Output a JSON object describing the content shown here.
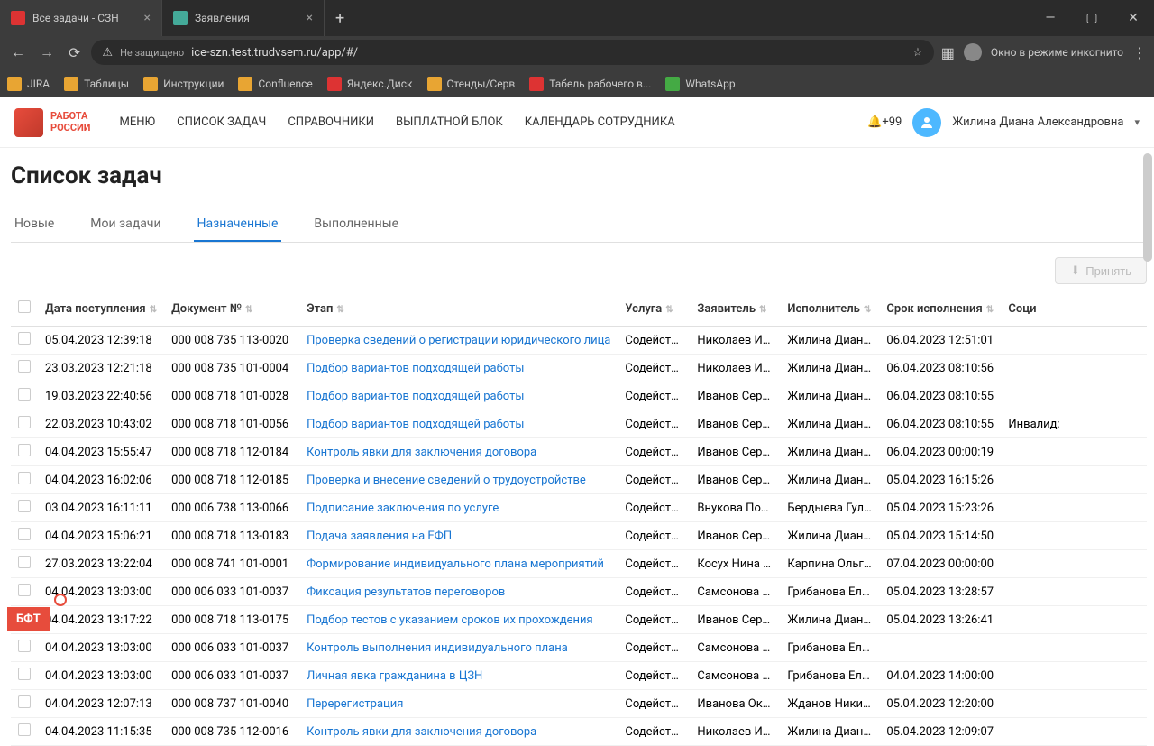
{
  "browser": {
    "tabs": [
      {
        "title": "Все задачи - СЗН",
        "active": true
      },
      {
        "title": "Заявления",
        "active": false
      }
    ],
    "url_warning": "Не защищено",
    "url": "ice-szn.test.trudvsem.ru/app/#/",
    "incognito_text": "Окно в режиме инкогнито",
    "bookmarks": [
      "JIRA",
      "Таблицы",
      "Инструкции",
      "Confluence",
      "Яндекс.Диск",
      "Стенды/Серв",
      "Табель рабочего в...",
      "WhatsApp"
    ]
  },
  "header": {
    "logo_line1": "РАБОТА",
    "logo_line2": "РОССИИ",
    "menu": [
      "МЕНЮ",
      "СПИСОК ЗАДАЧ",
      "СПРАВОЧНИКИ",
      "ВЫПЛАТНОЙ БЛОК",
      "КАЛЕНДАРЬ СОТРУДНИКА"
    ],
    "notif": "+99",
    "username": "Жилина Диана Александровна"
  },
  "page": {
    "title": "Список задач",
    "tabs": [
      "Новые",
      "Мои задачи",
      "Назначенные",
      "Выполненные"
    ],
    "active_tab": 2,
    "accept_btn": "Принять"
  },
  "table": {
    "headers": [
      "Дата поступления",
      "Документ №",
      "Этап",
      "Услуга",
      "Заявитель",
      "Исполнитель",
      "Срок исполнения",
      "Соци"
    ],
    "rows": [
      {
        "date": "05.04.2023 12:39:18",
        "doc": "000 008 735 113-0020",
        "stage": "Проверка сведений о регистрации юридического лица",
        "service": "Содействие ...",
        "applicant": "Николаев Игорь ...",
        "executor": "Жилина Диана Але...",
        "due": "06.04.2023 12:51:01",
        "soc": "",
        "hl": true
      },
      {
        "date": "23.03.2023 12:21:18",
        "doc": "000 008 735 101-0004",
        "stage": "Подбор вариантов подходящей работы",
        "service": "Содействие ...",
        "applicant": "Николаев Игорь ...",
        "executor": "Жилина Диана Але...",
        "due": "06.04.2023 08:10:56",
        "soc": ""
      },
      {
        "date": "19.03.2023 22:40:56",
        "doc": "000 008 718 101-0028",
        "stage": "Подбор вариантов подходящей работы",
        "service": "Содействие ...",
        "applicant": "Иванов Сергей П...",
        "executor": "Жилина Диана Але...",
        "due": "06.04.2023 08:10:55",
        "soc": ""
      },
      {
        "date": "22.03.2023 10:43:02",
        "doc": "000 008 718 101-0056",
        "stage": "Подбор вариантов подходящей работы",
        "service": "Содействие ...",
        "applicant": "Иванов Сергей П...",
        "executor": "Жилина Диана Але...",
        "due": "06.04.2023 08:10:55",
        "soc": "Инвалид; "
      },
      {
        "date": "04.04.2023 15:55:47",
        "doc": "000 008 718 112-0184",
        "stage": "Контроль явки для заключения договора",
        "service": "Содействие ...",
        "applicant": "Иванов Сергей П...",
        "executor": "Жилина Диана Але...",
        "due": "06.04.2023 00:00:19",
        "soc": ""
      },
      {
        "date": "04.04.2023 16:02:06",
        "doc": "000 008 718 112-0185",
        "stage": "Проверка и внесение сведений о трудоустройстве",
        "service": "Содействие ...",
        "applicant": "Иванов Сергей П...",
        "executor": "Жилина Диана Але...",
        "due": "05.04.2023 16:15:26",
        "soc": ""
      },
      {
        "date": "03.04.2023 16:11:11",
        "doc": "000 006 738 113-0066",
        "stage": "Подписание заключения по услуге",
        "service": "Содействие ...",
        "applicant": "Внукова Полина ...",
        "executor": "Бердыева Гульнаба...",
        "due": "05.04.2023 15:23:26",
        "soc": ""
      },
      {
        "date": "04.04.2023 15:06:21",
        "doc": "000 008 718 113-0183",
        "stage": "Подача заявления на ЕФП",
        "service": "Содействие ...",
        "applicant": "Иванов Сергей П...",
        "executor": "Жилина Диана Але...",
        "due": "05.04.2023 15:14:50",
        "soc": ""
      },
      {
        "date": "27.03.2023 13:22:04",
        "doc": "000 008 741 101-0001",
        "stage": "Формирование индивидуального плана мероприятий",
        "service": "Содействие ...",
        "applicant": "Косух Нина Нико...",
        "executor": "Карпина Ольга Иль...",
        "due": "07.04.2023 00:00:00",
        "soc": ""
      },
      {
        "date": "04.04.2023 13:03:00",
        "doc": "000 006 033 101-0037",
        "stage": "Фиксация результатов переговоров",
        "service": "Содействие ...",
        "applicant": "Самсонова Дарь...",
        "executor": "Грибанова Елена И...",
        "due": "05.04.2023 13:28:57",
        "soc": ""
      },
      {
        "date": "04.04.2023 13:17:22",
        "doc": "000 008 718 113-0175",
        "stage": "Подбор тестов с указанием сроков их прохождения",
        "service": "Содействие ...",
        "applicant": "Иванов Сергей П...",
        "executor": "Жилина Диана Але...",
        "due": "05.04.2023 13:26:41",
        "soc": ""
      },
      {
        "date": "04.04.2023 13:03:00",
        "doc": "000 006 033 101-0037",
        "stage": "Контроль выполнения индивидуального плана",
        "service": "Содействие ...",
        "applicant": "Самсонова Дарь...",
        "executor": "Грибанова Елена И...",
        "due": "",
        "soc": ""
      },
      {
        "date": "04.04.2023 13:03:00",
        "doc": "000 006 033 101-0037",
        "stage": "Личная явка гражданина в ЦЗН",
        "service": "Содействие ...",
        "applicant": "Самсонова Дарь...",
        "executor": "Грибанова Елена И...",
        "due": "04.04.2023 14:00:00",
        "soc": ""
      },
      {
        "date": "04.04.2023 12:07:13",
        "doc": "000 008 737 101-0040",
        "stage": "Перерегистрация",
        "service": "Содействие ...",
        "applicant": "Иванова Оксана ...",
        "executor": "Жданов Никита Вла...",
        "due": "05.04.2023 12:20:00",
        "soc": ""
      },
      {
        "date": "04.04.2023 11:15:35",
        "doc": "000 008 735 112-0016",
        "stage": "Контроль явки для заключения договора",
        "service": "Содействие ...",
        "applicant": "Николаев Игорь ...",
        "executor": "Жилина Диана Але...",
        "due": "05.04.2023 12:09:07",
        "soc": ""
      }
    ]
  },
  "bft": "БФТ"
}
